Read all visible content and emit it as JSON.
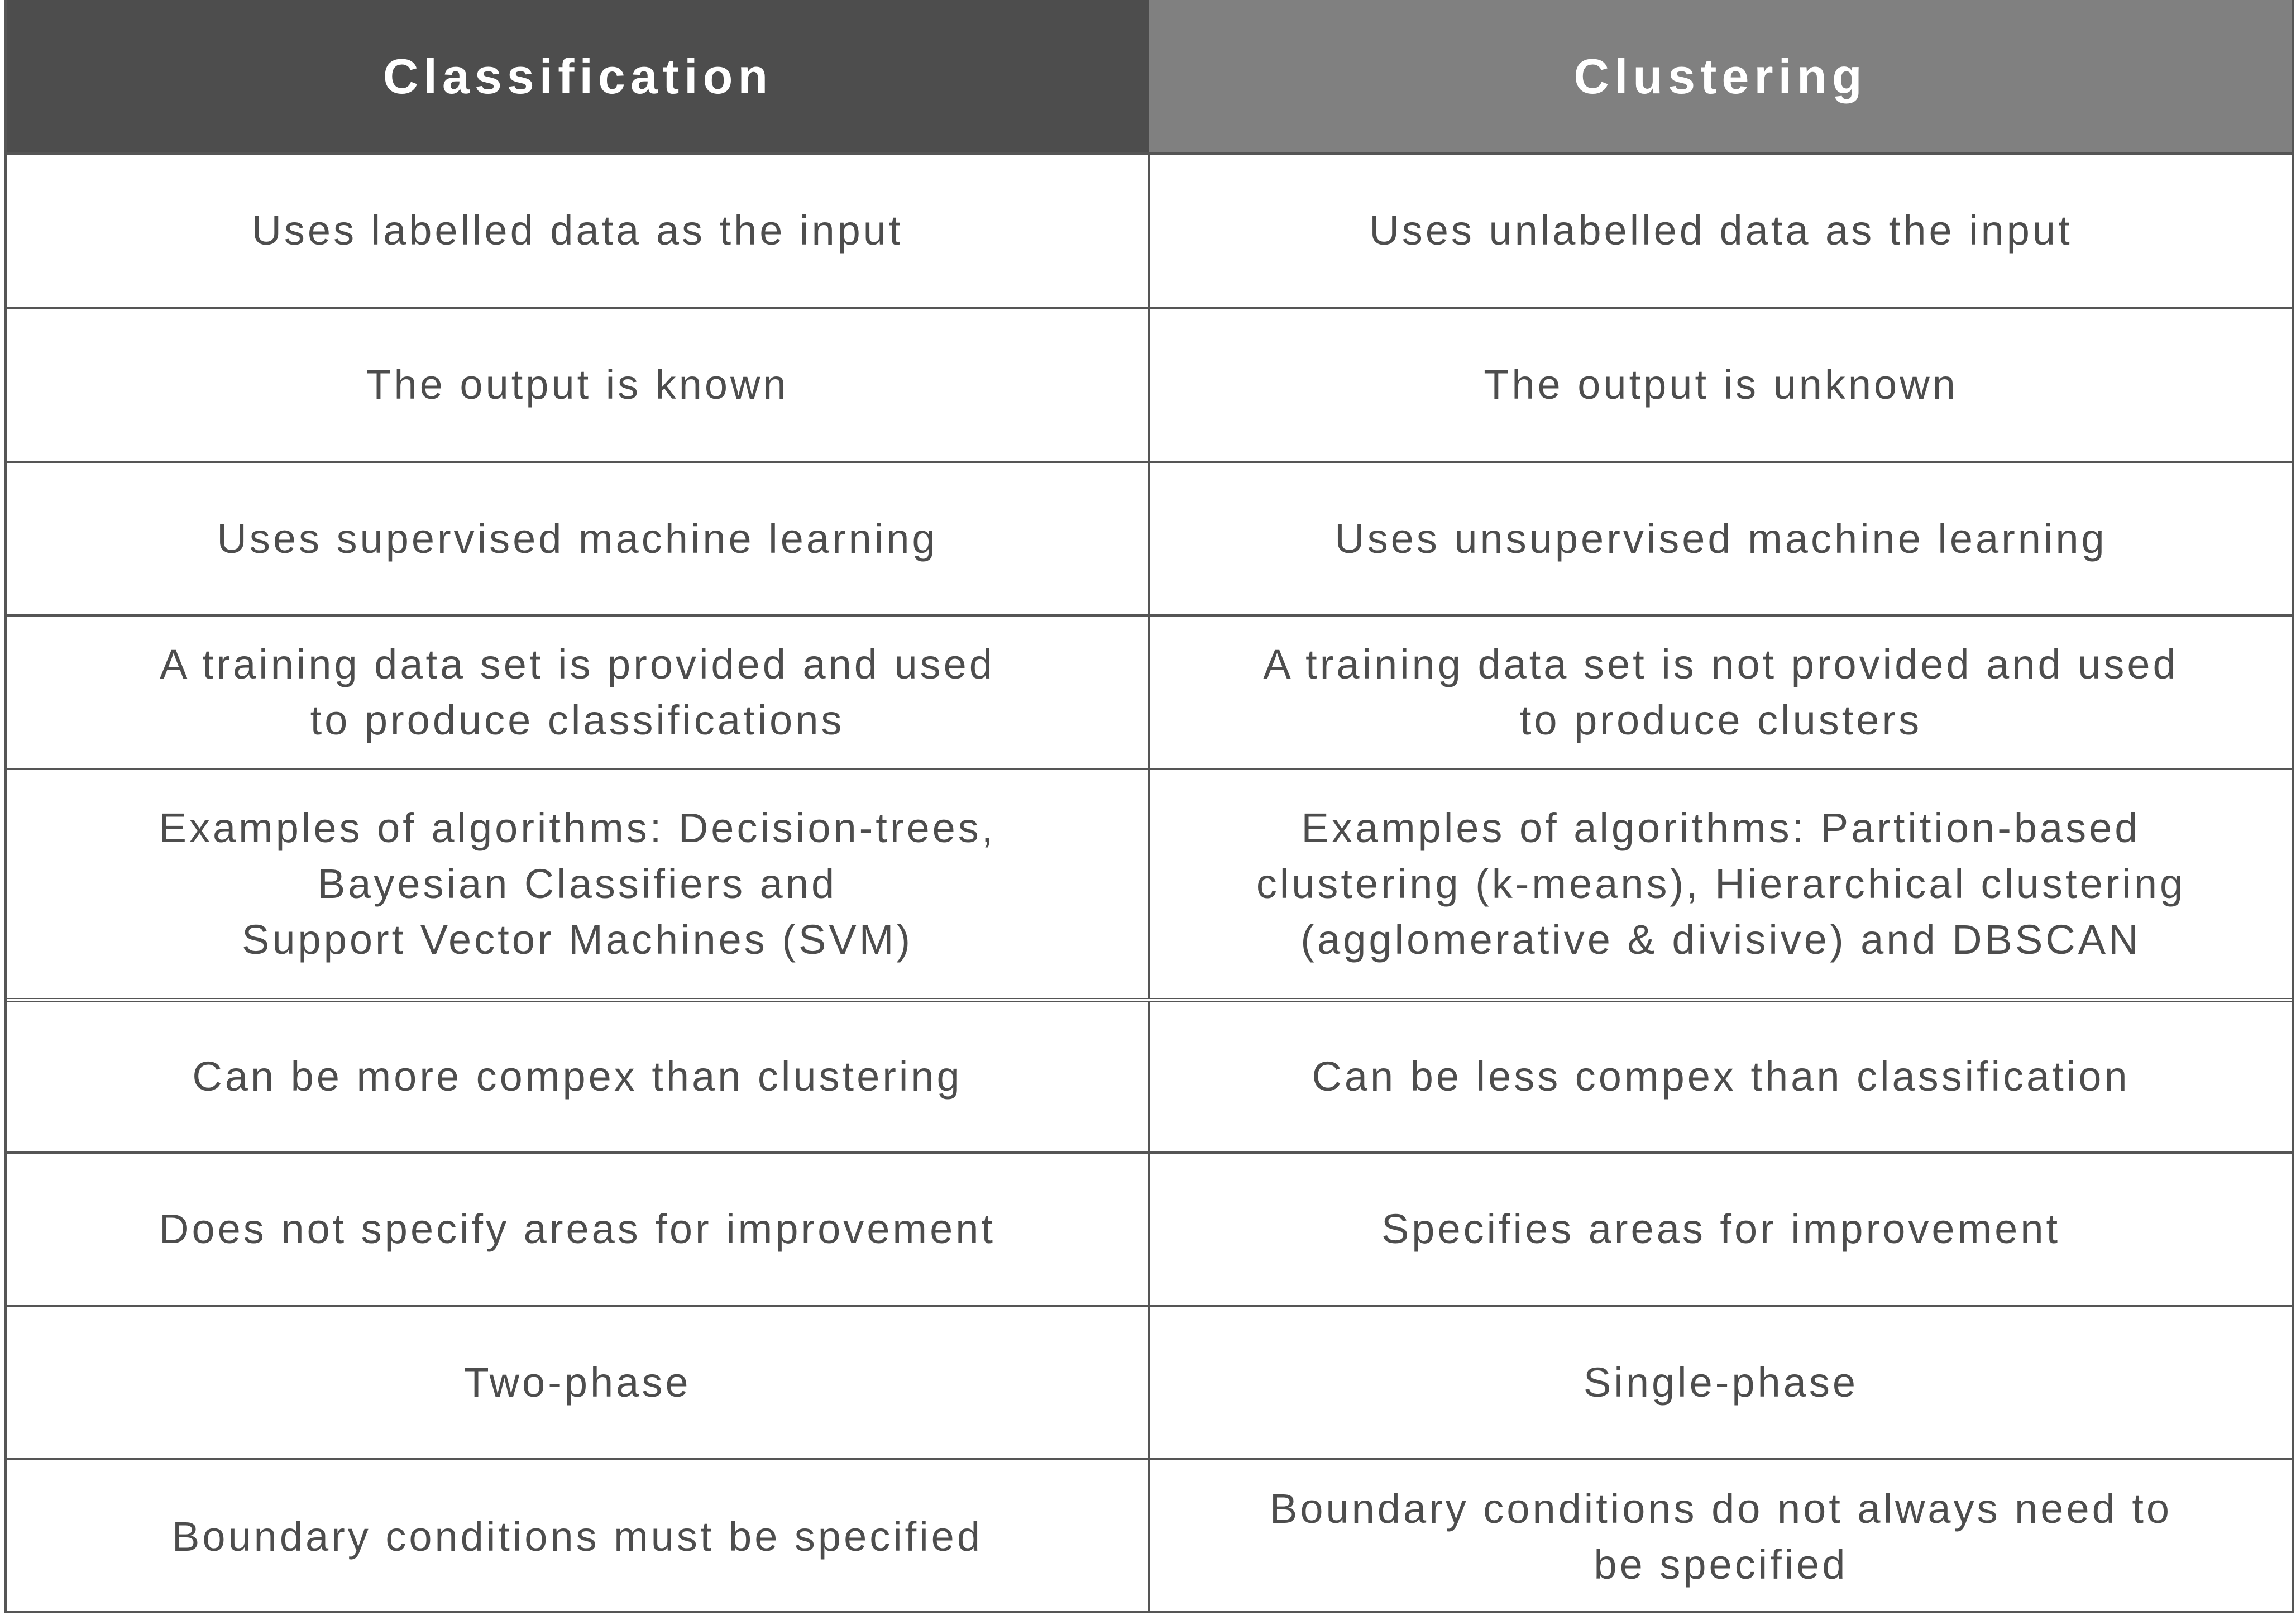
{
  "table": {
    "headers": [
      "Classification",
      "Clustering"
    ],
    "colors": {
      "header_left_bg": "#4d4d4d",
      "header_right_bg": "#808080",
      "text": "#4d4d4d",
      "border": "#555555"
    },
    "rows": [
      {
        "classification": "Uses labelled data as the input",
        "clustering": "Uses unlabelled data as the input"
      },
      {
        "classification": "The output is known",
        "clustering": "The output is unknown"
      },
      {
        "classification": "Uses supervised machine learning",
        "clustering": "Uses unsupervised machine learning"
      },
      {
        "classification": "A training data set is provided and used\nto produce classifications",
        "clustering": "A training data set is not provided and used\nto produce clusters"
      },
      {
        "classification": "Examples of algorithms: Decision-trees,\nBayesian Classifiers and\nSupport Vector Machines (SVM)",
        "clustering": "Examples of algorithms: Partition-based\nclustering (k-means), Hierarchical clustering\n(agglomerative & divisive) and DBSCAN"
      },
      {
        "classification": "Can be more compex than clustering",
        "clustering": "Can be less compex than classification"
      },
      {
        "classification": "Does not specify areas for improvement",
        "clustering": "Specifies areas for improvement"
      },
      {
        "classification": "Two-phase",
        "clustering": "Single-phase"
      },
      {
        "classification": "Boundary conditions must be specified",
        "clustering": "Boundary conditions do not always need to\nbe specified"
      }
    ]
  }
}
